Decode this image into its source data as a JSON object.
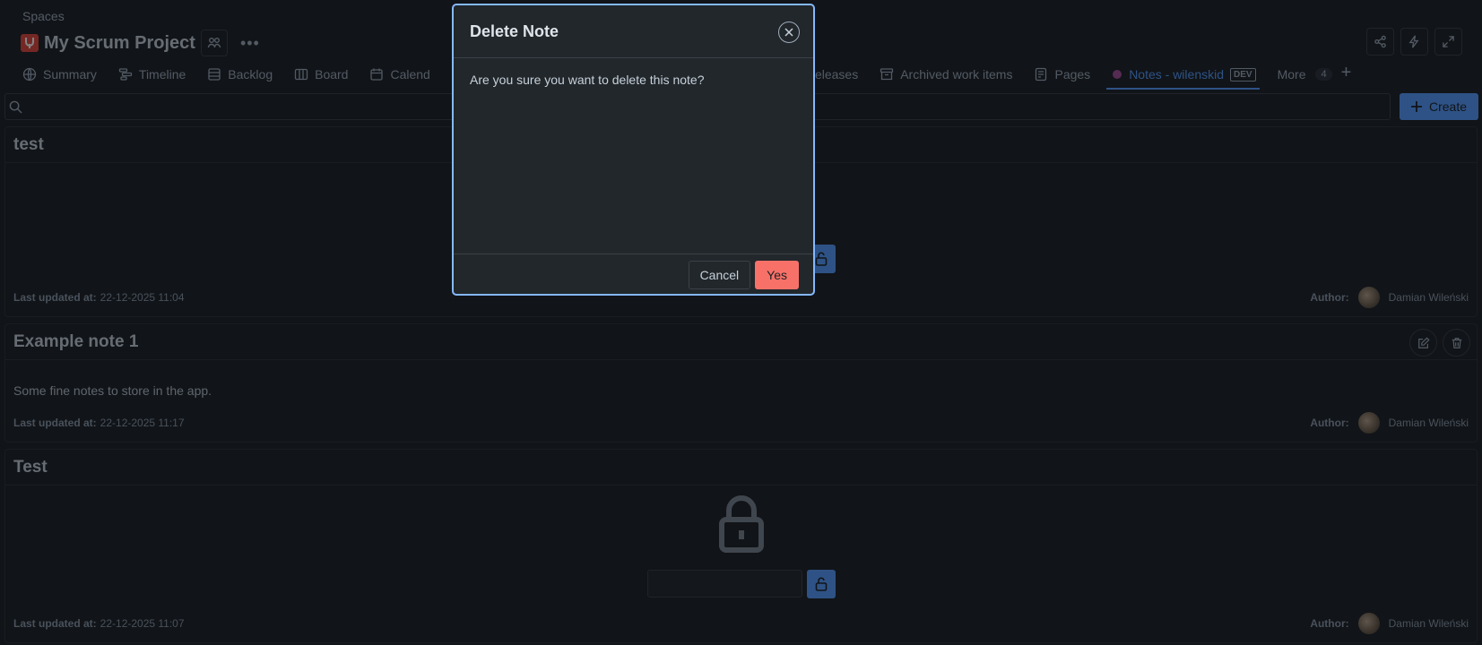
{
  "header": {
    "breadcrumb": "Spaces",
    "project_title": "My Scrum Project"
  },
  "tabs": [
    {
      "label": "Summary",
      "icon": "globe-icon"
    },
    {
      "label": "Timeline",
      "icon": "timeline-icon"
    },
    {
      "label": "Backlog",
      "icon": "backlog-icon"
    },
    {
      "label": "Board",
      "icon": "board-icon"
    },
    {
      "label": "Calend",
      "icon": "calendar-icon"
    },
    {
      "label": "Releases",
      "icon": "ship-icon"
    },
    {
      "label": "Archived work items",
      "icon": "archive-icon"
    },
    {
      "label": "Pages",
      "icon": "pages-icon"
    },
    {
      "label": "Notes - wilenskid",
      "icon": "notes-dot-icon",
      "badge": "DEV",
      "active": true
    },
    {
      "label": "More",
      "count": "4"
    }
  ],
  "toolbar": {
    "search_placeholder": "",
    "create_label": "Create"
  },
  "notes": [
    {
      "title": "test",
      "updated_label": "Last updated at:",
      "updated_value": "22-12-2025 11:04",
      "author_label": "Author:",
      "author_name": "Damian Wileński",
      "locked": true
    },
    {
      "title": "Example note 1",
      "body": "Some fine notes to store in the app.",
      "updated_label": "Last updated at:",
      "updated_value": "22-12-2025 11:17",
      "author_label": "Author:",
      "author_name": "Damian Wileński",
      "locked": false
    },
    {
      "title": "Test",
      "updated_label": "Last updated at:",
      "updated_value": "22-12-2025 11:07",
      "author_label": "Author:",
      "author_name": "Damian Wileński",
      "locked": true
    }
  ],
  "modal": {
    "title": "Delete Note",
    "message": "Are you sure you want to delete this note?",
    "cancel_label": "Cancel",
    "confirm_label": "Yes"
  },
  "colors": {
    "background": "#1d2125",
    "accent": "#579dff",
    "danger": "#f87168",
    "modal_border": "#85b8ff"
  }
}
